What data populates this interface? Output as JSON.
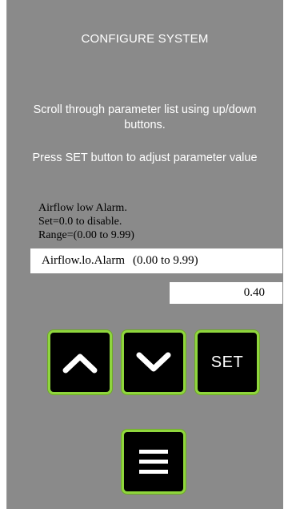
{
  "screen": {
    "title": "CONFIGURE SYSTEM",
    "instruction_scroll": "Scroll through parameter list using up/down buttons.",
    "instruction_set": "Press SET button to adjust parameter value"
  },
  "parameter": {
    "description": [
      "Airflow low Alarm.",
      "Set=0.0 to disable.",
      "Range=(0.00 to 9.99)"
    ],
    "name": "Airflow.lo.Alarm",
    "range": "(0.00 to 9.99)",
    "value": "0.40"
  },
  "buttons": {
    "up_icon": "chevron-up-icon",
    "down_icon": "chevron-down-icon",
    "set_label": "SET",
    "menu_icon": "menu-icon"
  },
  "colors": {
    "panel": "#8a8a8a",
    "button_bg": "#000000",
    "button_border": "#8fd63d",
    "text_light": "#ffffff"
  }
}
